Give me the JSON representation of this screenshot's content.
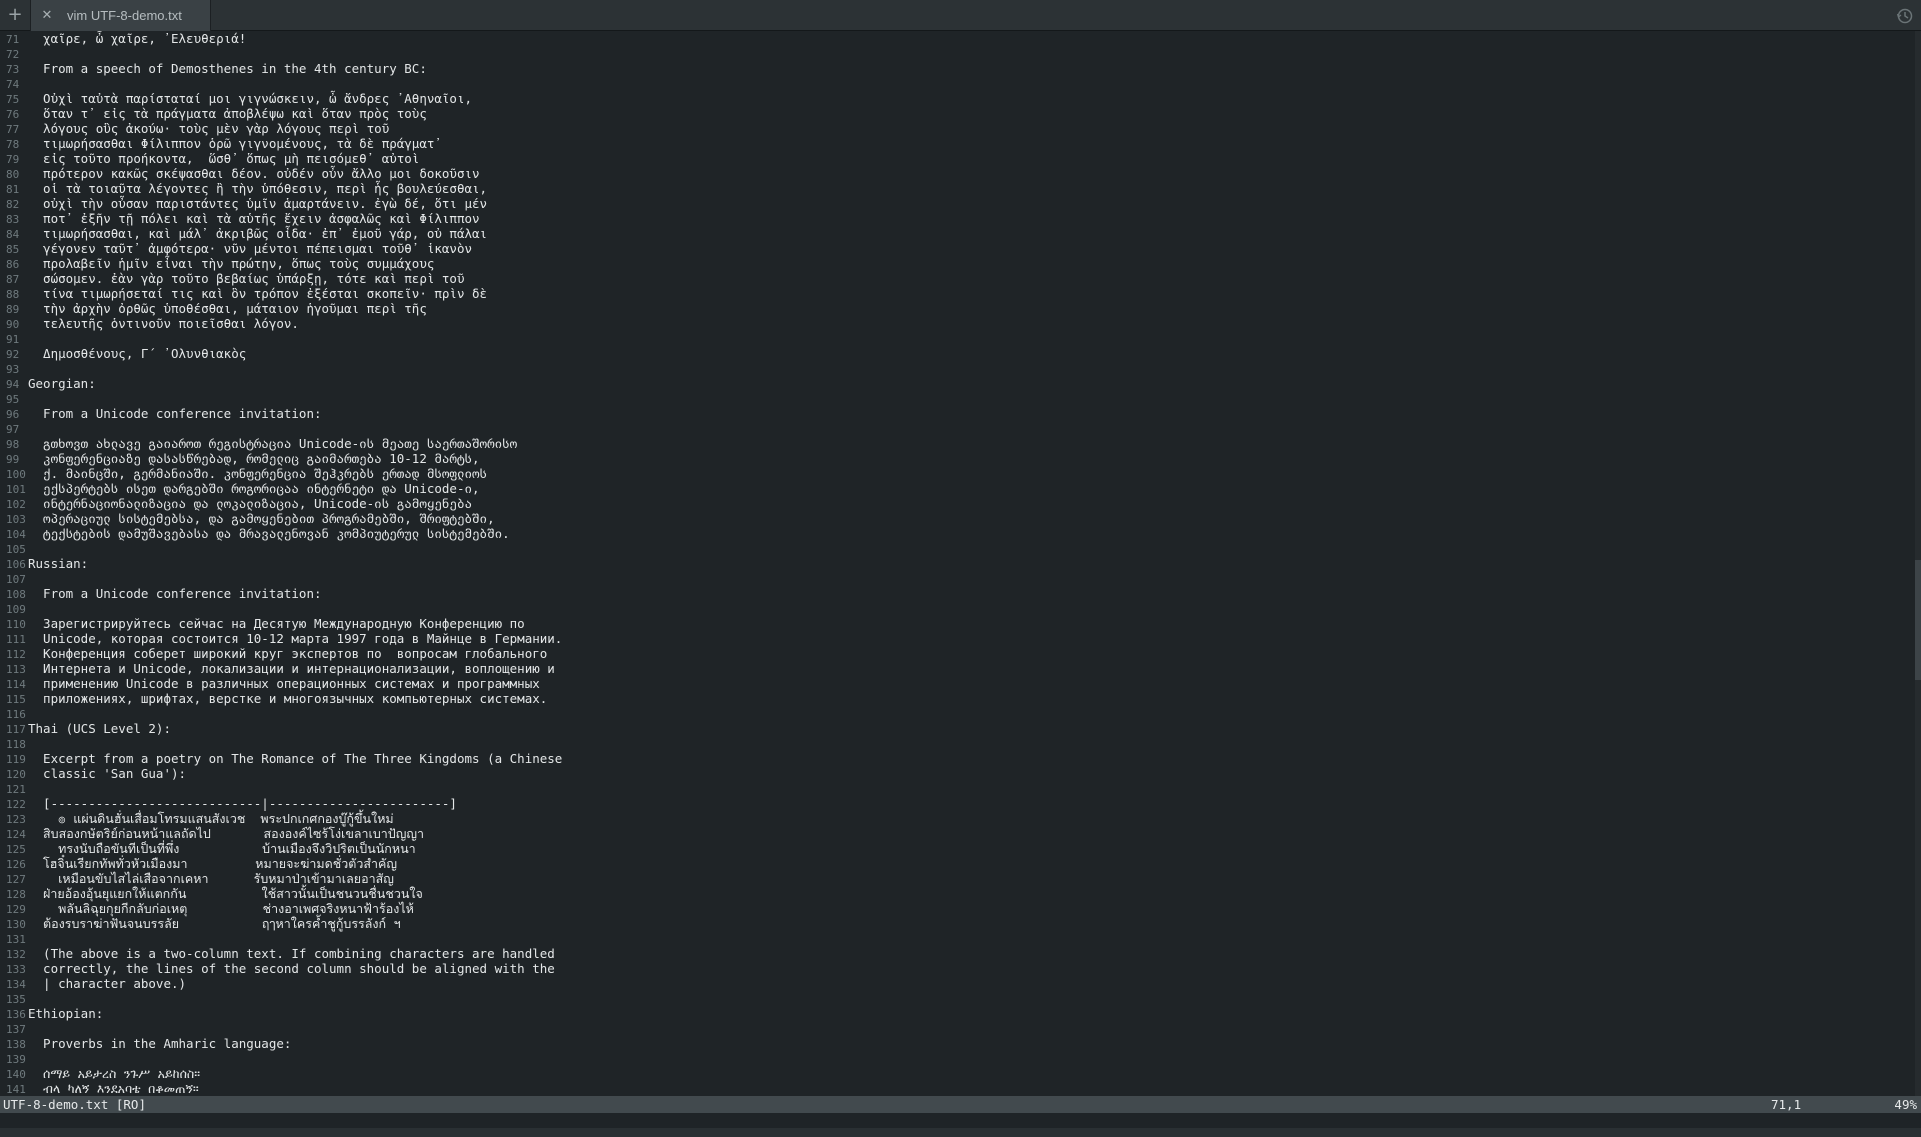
{
  "tabbar": {
    "new_tab_glyph": "+",
    "close_glyph": "✕",
    "tab_title": "vim UTF-8-demo.txt",
    "history_icon": "history-icon"
  },
  "editor": {
    "lines": [
      {
        "n": "71",
        "t": "  χαῖρε, ὦ χαῖρε, ᾿Ελευθεριά!"
      },
      {
        "n": "72",
        "t": ""
      },
      {
        "n": "73",
        "t": "  From a speech of Demosthenes in the 4th century BC:"
      },
      {
        "n": "74",
        "t": ""
      },
      {
        "n": "75",
        "t": "  Οὐχὶ ταὐτὰ παρίσταταί μοι γιγνώσκειν, ὦ ἄνδρες ᾿Αθηναῖοι,"
      },
      {
        "n": "76",
        "t": "  ὅταν τ᾿ εἰς τὰ πράγματα ἀποβλέψω καὶ ὅταν πρὸς τοὺς"
      },
      {
        "n": "77",
        "t": "  λόγους οὓς ἀκούω· τοὺς μὲν γὰρ λόγους περὶ τοῦ"
      },
      {
        "n": "78",
        "t": "  τιμωρήσασθαι Φίλιππον ὁρῶ γιγνομένους, τὰ δὲ πράγματ᾿"
      },
      {
        "n": "79",
        "t": "  εἰς τοῦτο προήκοντα,  ὥσθ᾿ ὅπως μὴ πεισόμεθ᾿ αὐτοὶ"
      },
      {
        "n": "80",
        "t": "  πρότερον κακῶς σκέψασθαι δέον. οὐδέν οὖν ἄλλο μοι δοκοῦσιν"
      },
      {
        "n": "81",
        "t": "  οἱ τὰ τοιαῦτα λέγοντες ἢ τὴν ὑπόθεσιν, περὶ ἧς βουλεύεσθαι,"
      },
      {
        "n": "82",
        "t": "  οὐχὶ τὴν οὖσαν παριστάντες ὑμῖν ἁμαρτάνειν. ἐγὼ δέ, ὅτι μέν"
      },
      {
        "n": "83",
        "t": "  ποτ᾿ ἐξῆν τῇ πόλει καὶ τὰ αὑτῆς ἔχειν ἀσφαλῶς καὶ Φίλιππον"
      },
      {
        "n": "84",
        "t": "  τιμωρήσασθαι, καὶ μάλ᾿ ἀκριβῶς οἶδα· ἐπ᾿ ἐμοῦ γάρ, οὐ πάλαι"
      },
      {
        "n": "85",
        "t": "  γέγονεν ταῦτ᾿ ἀμφότερα· νῦν μέντοι πέπεισμαι τοῦθ᾿ ἱκανὸν"
      },
      {
        "n": "86",
        "t": "  προλαβεῖν ἡμῖν εἶναι τὴν πρώτην, ὅπως τοὺς συμμάχους"
      },
      {
        "n": "87",
        "t": "  σώσομεν. ἐὰν γὰρ τοῦτο βεβαίως ὑπάρξῃ, τότε καὶ περὶ τοῦ"
      },
      {
        "n": "88",
        "t": "  τίνα τιμωρήσεταί τις καὶ ὃν τρόπον ἐξέσται σκοπεῖν· πρὶν δὲ"
      },
      {
        "n": "89",
        "t": "  τὴν ἀρχὴν ὀρθῶς ὑποθέσθαι, μάταιον ἡγοῦμαι περὶ τῆς"
      },
      {
        "n": "90",
        "t": "  τελευτῆς ὁντινοῦν ποιεῖσθαι λόγον."
      },
      {
        "n": "91",
        "t": ""
      },
      {
        "n": "92",
        "t": "  Δημοσθένους, Γ´ ᾿Ολυνθιακὸς"
      },
      {
        "n": "93",
        "t": ""
      },
      {
        "n": "94",
        "t": "Georgian:"
      },
      {
        "n": "95",
        "t": ""
      },
      {
        "n": "96",
        "t": "  From a Unicode conference invitation:"
      },
      {
        "n": "97",
        "t": ""
      },
      {
        "n": "98",
        "t": "  გთხოვთ ახლავე გაიაროთ რეგისტრაცია Unicode-ის მეათე საერთაშორისო"
      },
      {
        "n": "99",
        "t": "  კონფერენციაზე დასასწრებად, რომელიც გაიმართება 10-12 მარტს,"
      },
      {
        "n": "100",
        "t": "  ქ. მაინცში, გერმანიაში. კონფერენცია შეჰკრებს ერთად მსოფლიოს"
      },
      {
        "n": "101",
        "t": "  ექსპერტებს ისეთ დარგებში როგორიცაა ინტერნეტი და Unicode-ი,"
      },
      {
        "n": "102",
        "t": "  ინტერნაციონალიზაცია და ლოკალიზაცია, Unicode-ის გამოყენება"
      },
      {
        "n": "103",
        "t": "  ოპერაციულ სისტემებსა, და გამოყენებით პროგრამებში, შრიფტებში,"
      },
      {
        "n": "104",
        "t": "  ტექსტების დამუშავებასა და მრავალენოვან კომპიუტერულ სისტემებში."
      },
      {
        "n": "105",
        "t": ""
      },
      {
        "n": "106",
        "t": "Russian:"
      },
      {
        "n": "107",
        "t": ""
      },
      {
        "n": "108",
        "t": "  From a Unicode conference invitation:"
      },
      {
        "n": "109",
        "t": ""
      },
      {
        "n": "110",
        "t": "  Зарегистрируйтесь сейчас на Десятую Международную Конференцию по"
      },
      {
        "n": "111",
        "t": "  Unicode, которая состоится 10-12 марта 1997 года в Майнце в Германии."
      },
      {
        "n": "112",
        "t": "  Конференция соберет широкий круг экспертов по  вопросам глобального"
      },
      {
        "n": "113",
        "t": "  Интернета и Unicode, локализации и интернационализации, воплощению и"
      },
      {
        "n": "114",
        "t": "  применению Unicode в различных операционных системах и программных"
      },
      {
        "n": "115",
        "t": "  приложениях, шрифтах, верстке и многоязычных компьютерных системах."
      },
      {
        "n": "116",
        "t": ""
      },
      {
        "n": "117",
        "t": "Thai (UCS Level 2):"
      },
      {
        "n": "118",
        "t": ""
      },
      {
        "n": "119",
        "t": "  Excerpt from a poetry on The Romance of The Three Kingdoms (a Chinese"
      },
      {
        "n": "120",
        "t": "  classic 'San Gua'):"
      },
      {
        "n": "121",
        "t": ""
      },
      {
        "n": "122",
        "t": "  [----------------------------|------------------------]"
      },
      {
        "n": "123",
        "t": "    ๏ แผ่นดินฮั่นเสื่อมโทรมแสนสังเวช  พระปกเกศกองบู๊กู้ขึ้นใหม่"
      },
      {
        "n": "124",
        "t": "  สิบสองกษัตริย์ก่อนหน้าแลถัดไป       สององค์ไซร้โง่เขลาเบาปัญญา"
      },
      {
        "n": "125",
        "t": "    ทรงนับถือขันทีเป็นที่พึ่ง           บ้านเมืองจึงวิปริตเป็นนักหนา"
      },
      {
        "n": "126",
        "t": "  โฮจิ๋นเรียกทัพทั่วหัวเมืองมา         หมายจะฆ่ามดชั่วตัวสำคัญ"
      },
      {
        "n": "127",
        "t": "    เหมือนขับไสไล่เสือจากเคหา      รับหมาป่าเข้ามาเลยอาสัญ"
      },
      {
        "n": "128",
        "t": "  ฝ่ายอ้องอุ้นยุแยกให้แตกกัน          ใช้สาวนั้นเป็นชนวนชื่นชวนใจ"
      },
      {
        "n": "129",
        "t": "    พลันลิฉุยกุยกีกลับก่อเหตุ          ช่างอาเพศจริงหนาฟ้าร้องไห้"
      },
      {
        "n": "130",
        "t": "  ต้องรบราฆ่าฟันจนบรรลัย           ฤๅหาใครค้ำชูกู้บรรลังก์ ฯ"
      },
      {
        "n": "131",
        "t": ""
      },
      {
        "n": "132",
        "t": "  (The above is a two-column text. If combining characters are handled"
      },
      {
        "n": "133",
        "t": "  correctly, the lines of the second column should be aligned with the"
      },
      {
        "n": "134",
        "t": "  | character above.)"
      },
      {
        "n": "135",
        "t": ""
      },
      {
        "n": "136",
        "t": "Ethiopian:"
      },
      {
        "n": "137",
        "t": ""
      },
      {
        "n": "138",
        "t": "  Proverbs in the Amharic language:"
      },
      {
        "n": "139",
        "t": ""
      },
      {
        "n": "140",
        "t": "  ሰማይ አይታረስ ንጉሥ አይከሰስ።"
      },
      {
        "n": "141",
        "t": "  ብላ ካለኝ እንደአባቴ በቆመጠኝ።"
      }
    ]
  },
  "statusline": {
    "file": "UTF-8-demo.txt [RO]",
    "position": "71,1",
    "percent": "49%"
  }
}
